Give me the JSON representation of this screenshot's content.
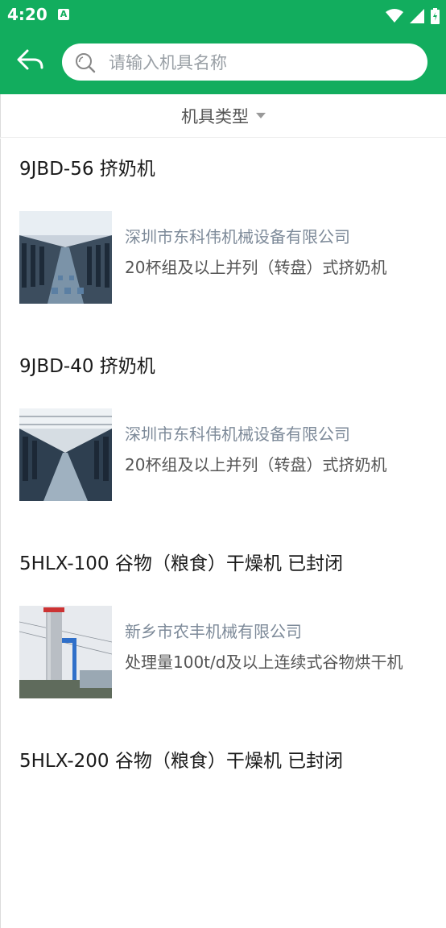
{
  "status_bar": {
    "time": "4:20",
    "notification_icon": "A"
  },
  "header": {
    "back_icon": "back-arrow-icon"
  },
  "search": {
    "placeholder": "请输入机具名称",
    "value": ""
  },
  "filter": {
    "label": "机具类型"
  },
  "items": [
    {
      "title": "9JBD-56 挤奶机",
      "company": "深圳市东科伟机械设备有限公司",
      "description": "20杯组及以上并列（转盘）式挤奶机"
    },
    {
      "title": "9JBD-40 挤奶机",
      "company": "深圳市东科伟机械设备有限公司",
      "description": "20杯组及以上并列（转盘）式挤奶机"
    },
    {
      "title": "5HLX-100 谷物（粮食）干燥机 已封闭",
      "company": "新乡市农丰机械有限公司",
      "description": "处理量100t/d及以上连续式谷物烘干机"
    },
    {
      "title": "5HLX-200 谷物（粮食）干燥机 已封闭",
      "company": "",
      "description": ""
    }
  ],
  "colors": {
    "primary": "#12ad5e",
    "company_text": "#7d8a99"
  }
}
